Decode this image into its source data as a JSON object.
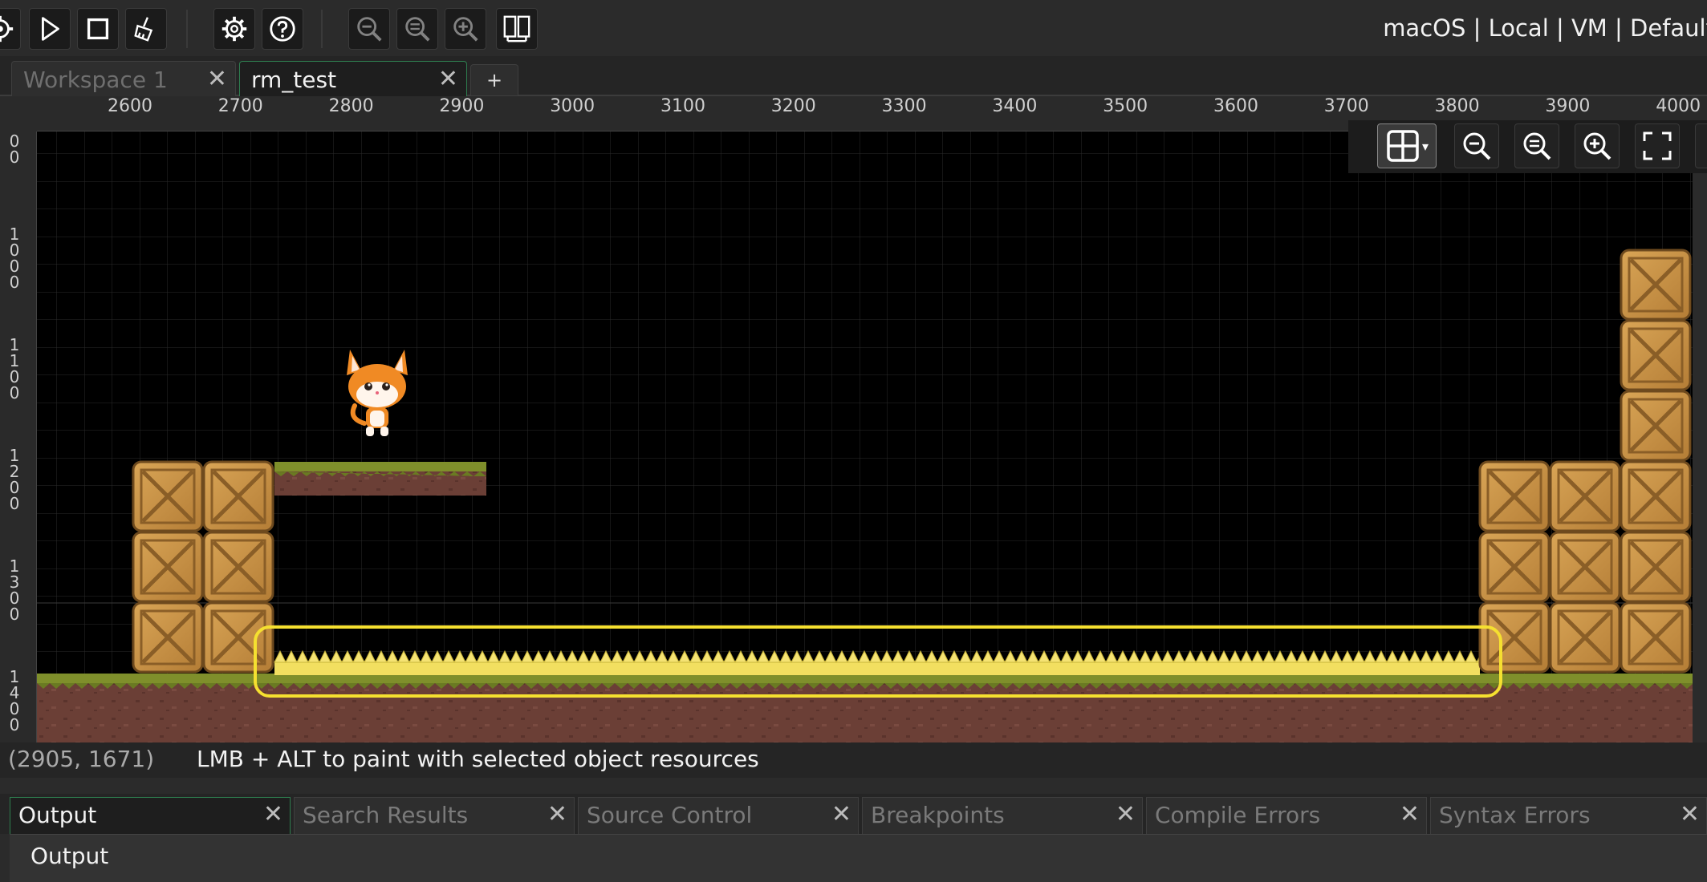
{
  "toolbar": {
    "buttons": [
      {
        "name": "build-icon",
        "dim": false
      },
      {
        "name": "run-icon",
        "dim": false
      },
      {
        "name": "stop-icon",
        "dim": false
      },
      {
        "name": "clean-icon",
        "dim": false
      },
      {
        "name": "settings-icon",
        "dim": false
      },
      {
        "name": "help-icon",
        "dim": false
      },
      {
        "name": "zoom-reset-icon",
        "dim": true
      },
      {
        "name": "zoom-out-icon",
        "dim": true
      },
      {
        "name": "zoom-in-icon",
        "dim": true
      },
      {
        "name": "gamepad-icon",
        "dim": false
      }
    ],
    "target": "macOS | Local | VM | Default"
  },
  "tabs": [
    {
      "label": "Workspace 1",
      "active": false
    },
    {
      "label": "rm_test",
      "active": true
    }
  ],
  "tab_add": "+",
  "ruler": {
    "x_ticks": [
      "2600",
      "2700",
      "2800",
      "2900",
      "3000",
      "3100",
      "3200",
      "3300",
      "3400",
      "3500",
      "3600",
      "3700",
      "3800",
      "3900",
      "4000"
    ],
    "y_ticks": [
      "00",
      "1000",
      "1100",
      "1200",
      "1300",
      "1400"
    ]
  },
  "room": {
    "player": "cat-character",
    "tiles": {
      "crate": "crate",
      "grass": "grass-dirt",
      "spikes": "spikes"
    },
    "selection_color": "#f5e030"
  },
  "view_tools": [
    "grid-toggle-icon",
    "zoom-out-icon",
    "zoom-reset-icon",
    "zoom-in-icon",
    "fullscreen-icon"
  ],
  "status": {
    "coords": "(2905, 1671)",
    "hint": "LMB + ALT to paint with selected object resources"
  },
  "output_tabs": [
    {
      "label": "Output",
      "active": true
    },
    {
      "label": "Search Results",
      "active": false
    },
    {
      "label": "Source Control",
      "active": false
    },
    {
      "label": "Breakpoints",
      "active": false
    },
    {
      "label": "Compile Errors",
      "active": false
    },
    {
      "label": "Syntax Errors",
      "active": false
    }
  ],
  "output_panel": {
    "title": "Output"
  }
}
